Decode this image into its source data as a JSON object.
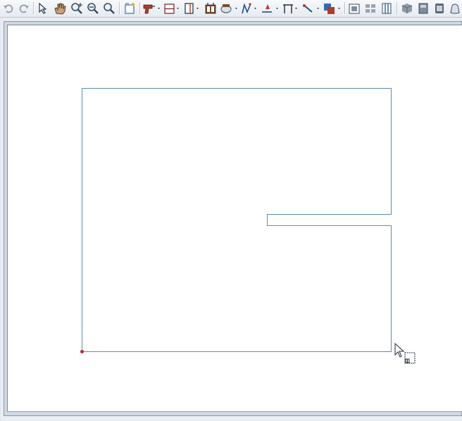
{
  "app": {
    "toolbar": {
      "buttons": [
        {
          "name": "undo-icon"
        },
        {
          "name": "redo-icon"
        },
        {
          "name": "select-objects-icon"
        },
        {
          "name": "pan-hand-icon"
        },
        {
          "name": "zoom-icon"
        },
        {
          "name": "zoom-out-icon"
        },
        {
          "name": "fill-window-icon"
        },
        {
          "name": "select-window-icon"
        },
        {
          "name": "drill-tool-icon"
        },
        {
          "name": "wall-tool-icon"
        },
        {
          "name": "door-window-icon"
        },
        {
          "name": "cabinet-icon"
        },
        {
          "name": "fixture-icon"
        },
        {
          "name": "stair-tool-icon"
        },
        {
          "name": "text-dimension-icon"
        },
        {
          "name": "frame-tool-icon"
        },
        {
          "name": "line-tool-icon"
        },
        {
          "name": "library-icon"
        },
        {
          "name": "camera-view-icon"
        },
        {
          "name": "layer-display-icon"
        },
        {
          "name": "column-view-icon"
        },
        {
          "name": "3d-box-icon"
        },
        {
          "name": "elevation-icon"
        },
        {
          "name": "panel-icon"
        },
        {
          "name": "materials-bag-icon"
        }
      ]
    },
    "colors": {
      "wall_line": "#5b8fb3",
      "corner_dot": "#c0262d",
      "canvas": "#ffffff"
    }
  }
}
